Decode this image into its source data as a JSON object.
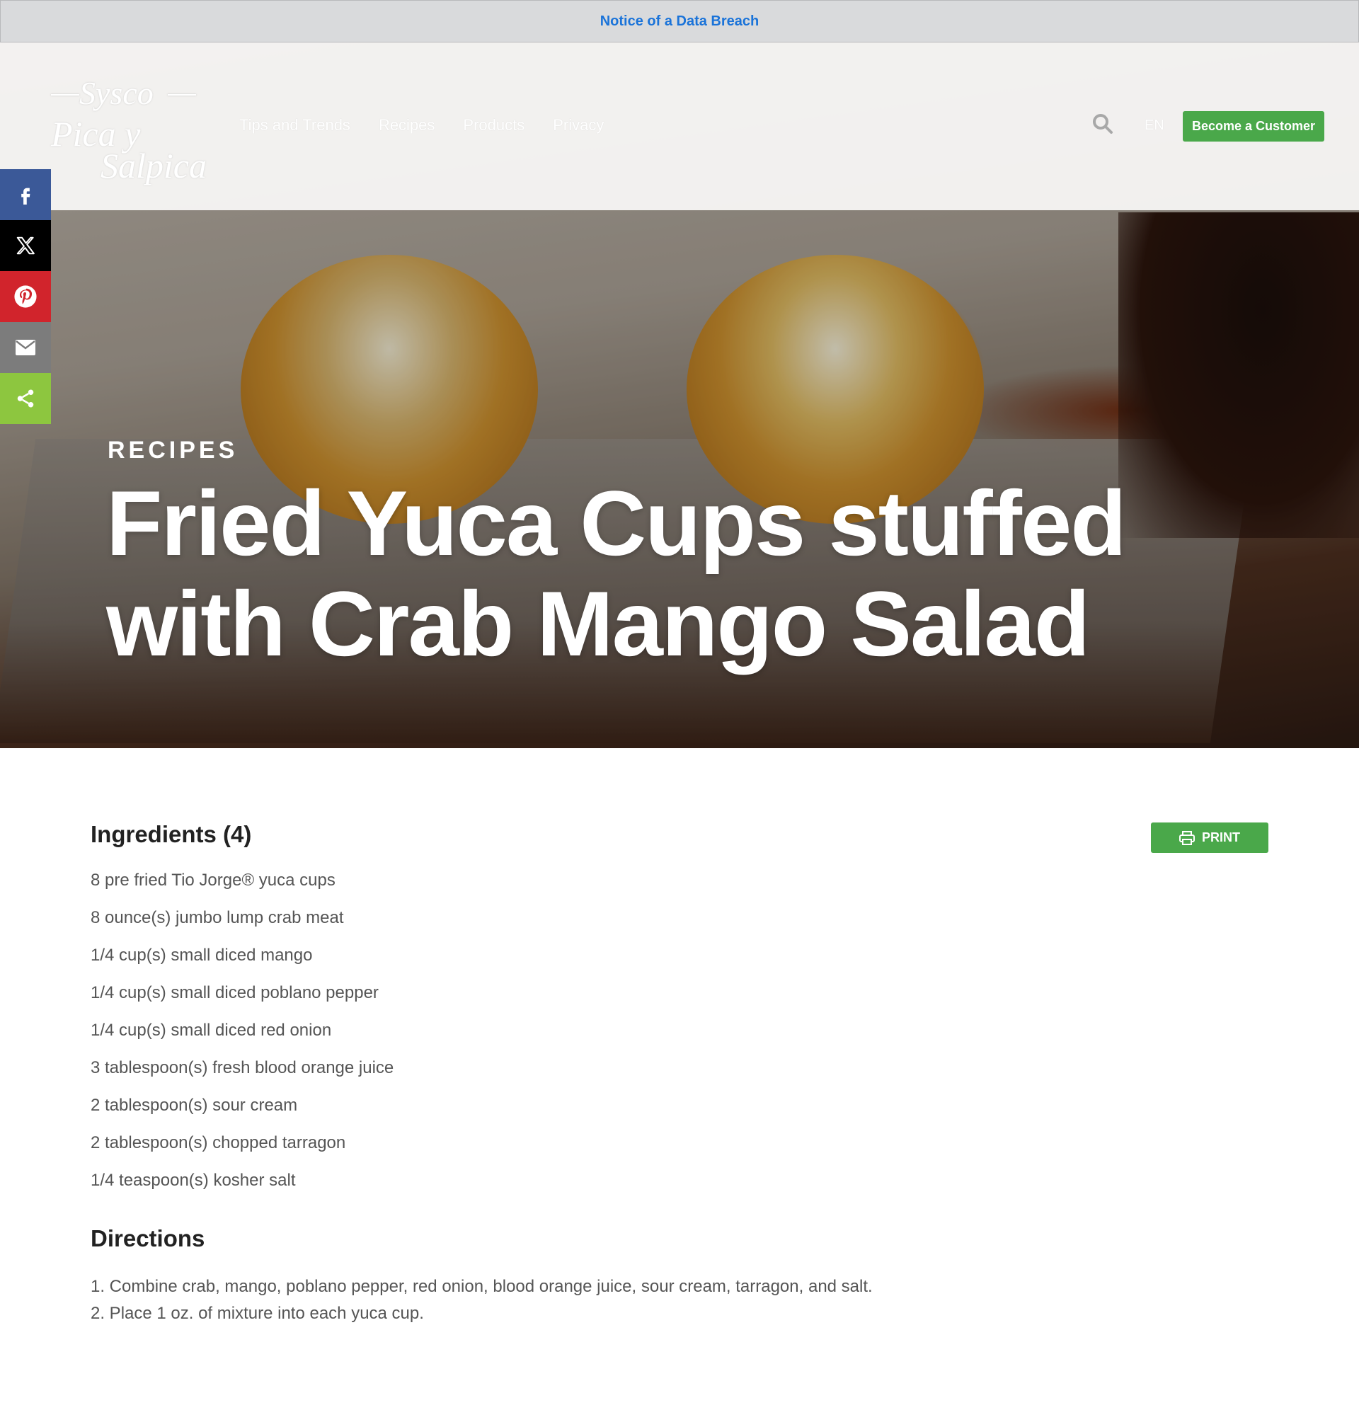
{
  "notice": {
    "text": "Notice of a Data Breach"
  },
  "header": {
    "logo": {
      "line1": "Sysco",
      "line2": "Pica y",
      "line3": "Salpica"
    },
    "nav": [
      {
        "label": "Tips and Trends"
      },
      {
        "label": "Recipes"
      },
      {
        "label": "Products"
      },
      {
        "label": "Privacy"
      }
    ],
    "language": "EN",
    "cta_label": "Become a Customer"
  },
  "social": {
    "items": [
      {
        "name": "facebook-icon",
        "color": "#3b5998"
      },
      {
        "name": "x-icon",
        "color": "#000000"
      },
      {
        "name": "pinterest-icon",
        "color": "#d1242c"
      },
      {
        "name": "email-icon",
        "color": "#7c7c7c"
      },
      {
        "name": "share-icon",
        "color": "#8dc63f"
      }
    ]
  },
  "hero": {
    "kicker": "RECIPES",
    "title": "Fried Yuca Cups stuffed with Crab Mango Salad"
  },
  "ingredients": {
    "heading": "Ingredients (4)",
    "print_label": "PRINT",
    "items": [
      "8 pre fried Tio Jorge® yuca cups",
      "8 ounce(s) jumbo lump crab meat",
      "1/4 cup(s) small diced mango",
      "1/4 cup(s) small diced poblano pepper",
      "1/4 cup(s) small diced red onion",
      "3 tablespoon(s) fresh blood orange juice",
      "2 tablespoon(s) sour cream",
      "2 tablespoon(s) chopped tarragon",
      "1/4 teaspoon(s) kosher salt"
    ]
  },
  "directions": {
    "heading": "Directions",
    "steps": [
      "1. Combine crab, mango, poblano pepper, red onion, blood orange juice, sour cream, tarragon, and salt.",
      "2. Place 1 oz. of mixture into each yuca cup."
    ]
  },
  "colors": {
    "accent_green": "#4aa84a",
    "link_blue": "#1a73d9"
  }
}
